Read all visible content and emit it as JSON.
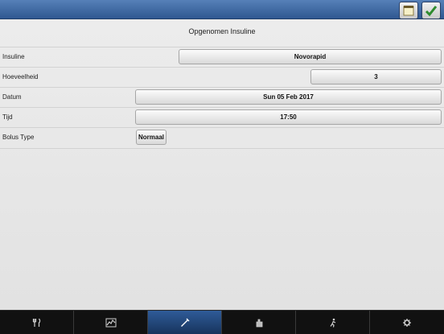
{
  "topbar": {
    "buttons": [
      {
        "icon": "notepad-icon"
      },
      {
        "icon": "checkmark-icon"
      }
    ]
  },
  "form": {
    "title": "Opgenomen Insuline",
    "rows": [
      {
        "label": "Insuline",
        "value": "Novorapid"
      },
      {
        "label": "Hoeveelheid",
        "value": "3"
      },
      {
        "label": "Datum",
        "value": "Sun 05 Feb 2017"
      },
      {
        "label": "Tijd",
        "value": "17:50"
      },
      {
        "label": "Bolus Type",
        "value": "Normaal"
      }
    ]
  },
  "tabs": [
    {
      "icon": "fork-knife-icon",
      "active": false
    },
    {
      "icon": "chart-icon",
      "active": false
    },
    {
      "icon": "syringe-icon",
      "active": true
    },
    {
      "icon": "hand-icon",
      "active": false
    },
    {
      "icon": "running-person-icon",
      "active": false
    },
    {
      "icon": "gear-icon",
      "active": false
    }
  ],
  "colors": {
    "topbar": "#3c6aa8",
    "active_tab": "#2f5b98",
    "checkmark": "#2e8b2e"
  }
}
